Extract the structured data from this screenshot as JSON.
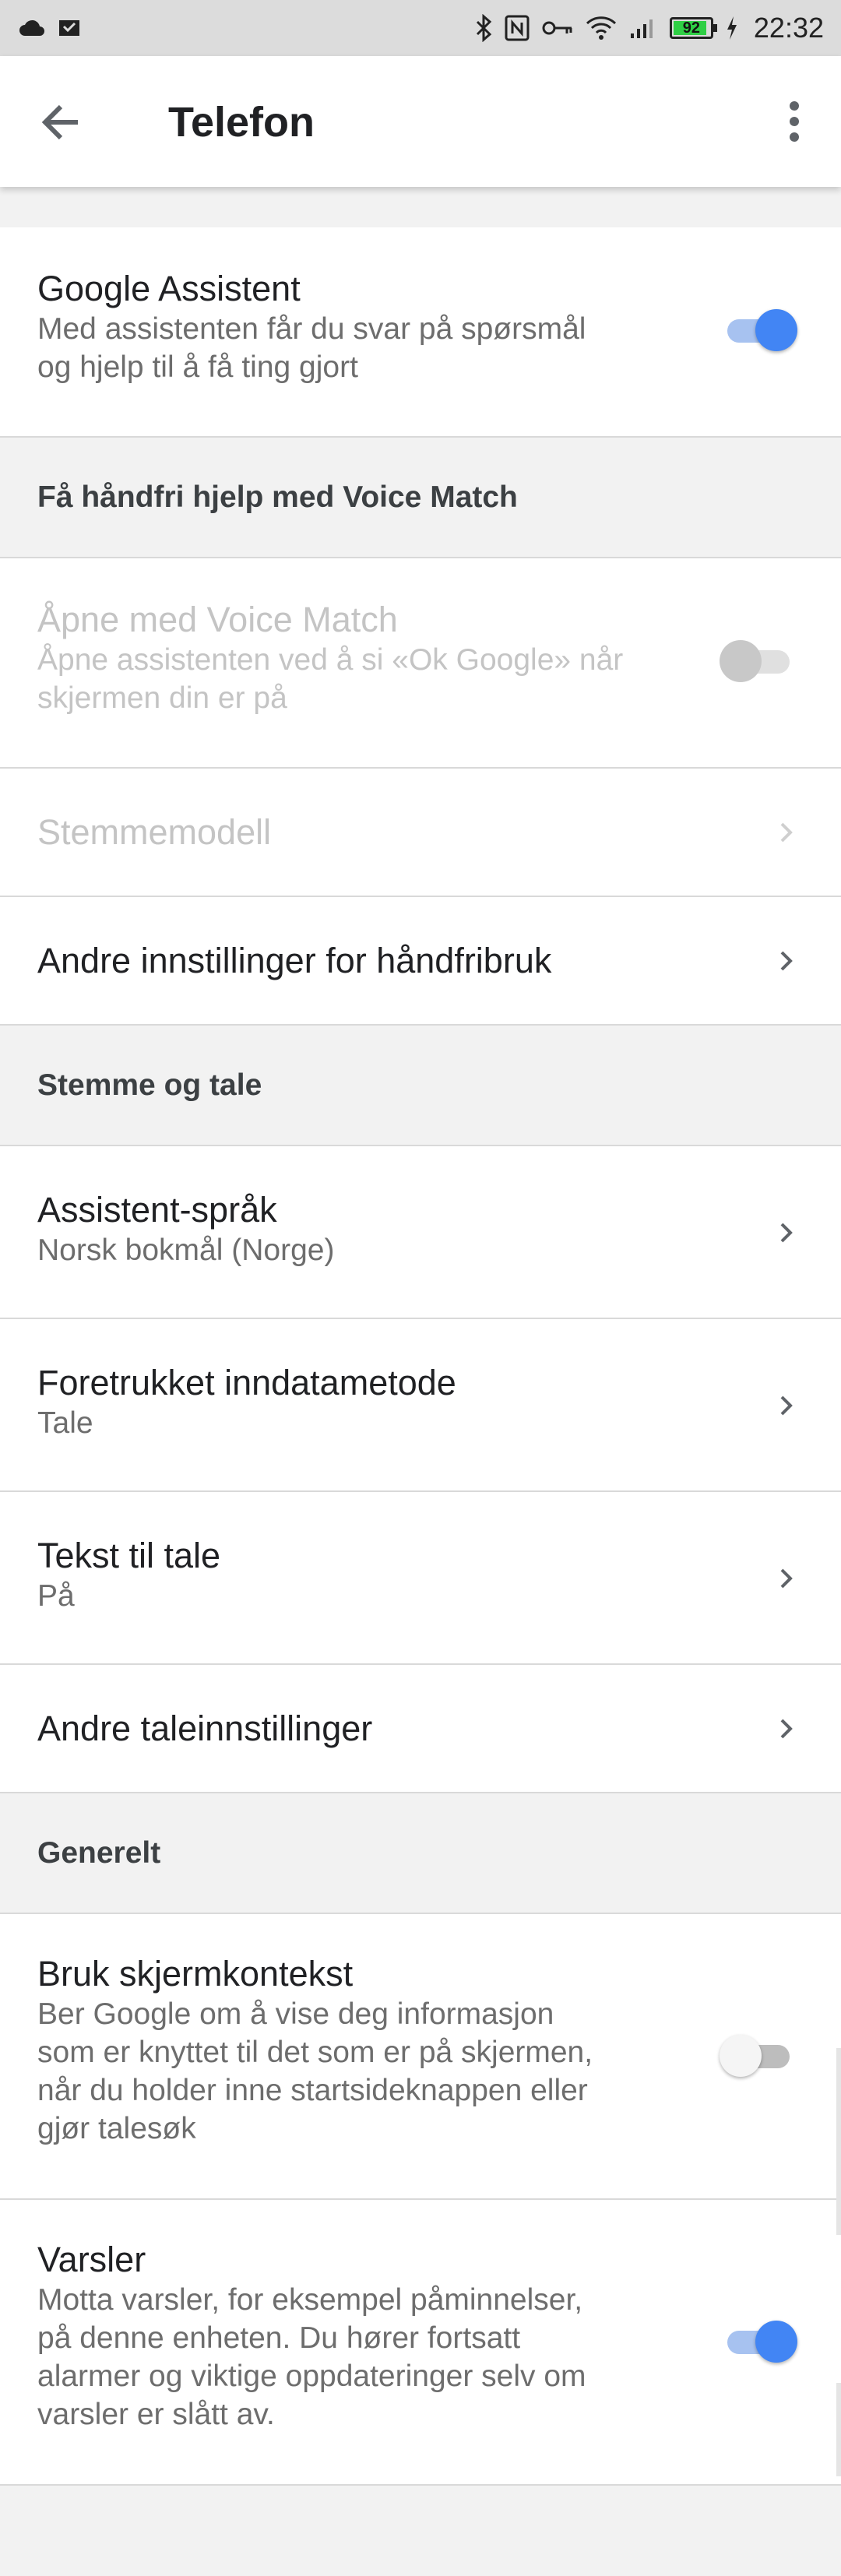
{
  "status_bar": {
    "time": "22:32",
    "battery_percent": "92",
    "left_icons": [
      "cloud-icon",
      "download-icon"
    ],
    "right_icons": [
      "bluetooth-icon",
      "nfc-icon",
      "vpn-key-icon",
      "wifi-icon",
      "signal-icon",
      "battery-icon",
      "charging-icon"
    ]
  },
  "app_bar": {
    "title": "Telefon"
  },
  "colors": {
    "accent": "#4285f4",
    "section_bg": "#f2f2f2",
    "divider": "#d9d9d9"
  },
  "assistant": {
    "title": "Google Assistent",
    "subtitle_line1": "Med assistenten får du svar på spørsmål",
    "subtitle_line2": "og hjelp til å få ting gjort",
    "enabled": true
  },
  "sections": {
    "voice_match": "Få håndfri hjelp med Voice Match",
    "voice_speech": "Stemme og tale",
    "general": "Generelt"
  },
  "voice_match": {
    "title": "Åpne med Voice Match",
    "subtitle_line1": "Åpne assistenten ved å si «Ok Google» når",
    "subtitle_line2": "skjermen din er på",
    "enabled": false
  },
  "stemmemodell": {
    "title": "Stemmemodell"
  },
  "handsfree": {
    "title": "Andre innstillinger for håndfribruk"
  },
  "language": {
    "title": "Assistent-språk",
    "subtitle": "Norsk bokmål (Norge)"
  },
  "input_method": {
    "title": "Foretrukket inndatametode",
    "subtitle": "Tale"
  },
  "tts": {
    "title": "Tekst til tale",
    "subtitle": "På"
  },
  "other_speech": {
    "title": "Andre taleinnstillinger"
  },
  "screen_context": {
    "title": "Bruk skjermkontekst",
    "subtitle_line1": "Ber Google om å vise deg informasjon",
    "subtitle_line2": "som er knyttet til det som er på skjermen,",
    "subtitle_line3": "når du holder inne startsideknappen eller",
    "subtitle_line4": "gjør talesøk",
    "enabled": false
  },
  "notifications": {
    "title": "Varsler",
    "subtitle_line1": "Motta varsler, for eksempel påminnelser,",
    "subtitle_line2": "på denne enheten. Du hører fortsatt",
    "subtitle_line3": "alarmer og viktige oppdateringer selv om",
    "subtitle_line4": "varsler er slått av.",
    "enabled": true
  }
}
